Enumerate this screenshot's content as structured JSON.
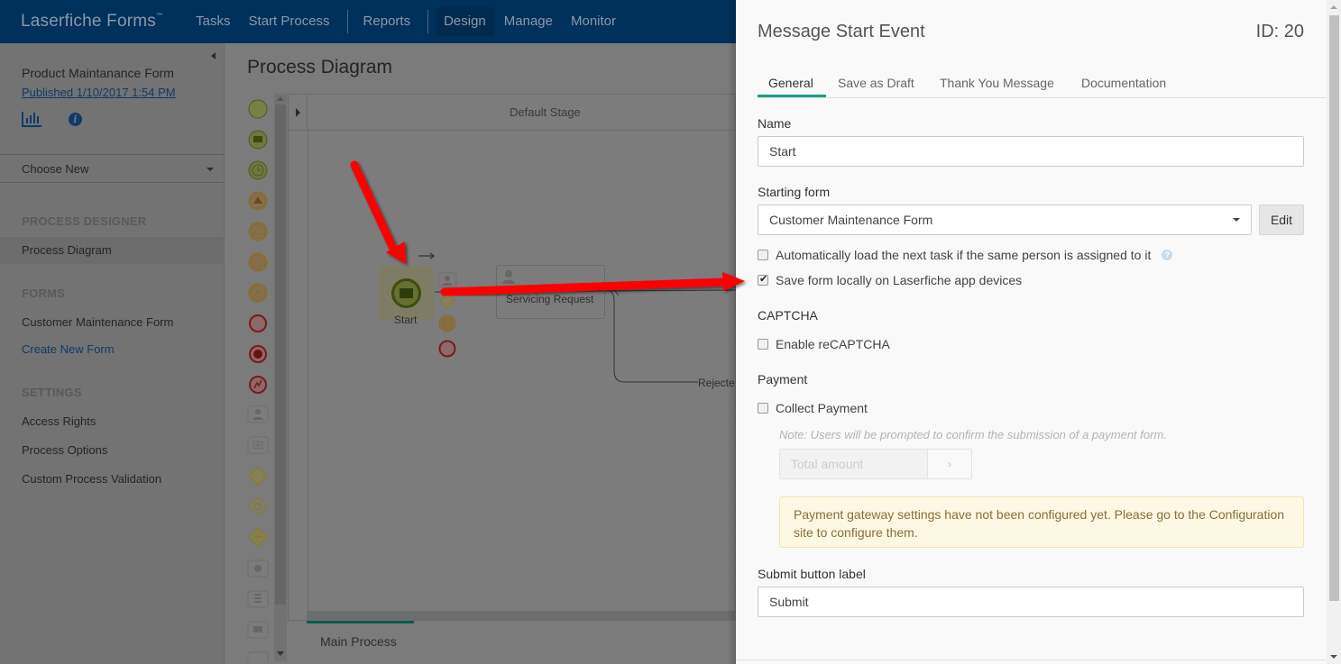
{
  "topnav": {
    "brand": "Laserfiche Forms",
    "brand_tm": "™",
    "items": [
      {
        "label": "Tasks"
      },
      {
        "label": "Start Process"
      },
      {
        "label": "Reports"
      },
      {
        "label": "Design",
        "active": true
      },
      {
        "label": "Manage"
      },
      {
        "label": "Monitor"
      }
    ]
  },
  "sidebar": {
    "process_name": "Product Maintanance Form",
    "published": "Published 1/10/2017 1:54 PM",
    "icons": [
      "report-chart-icon",
      "info-icon"
    ],
    "choose_new": "Choose New",
    "sections": [
      {
        "title": "PROCESS DESIGNER",
        "items": [
          {
            "label": "Process Diagram",
            "active": true
          }
        ]
      },
      {
        "title": "FORMS",
        "items": [
          {
            "label": "Customer Maintenance Form"
          },
          {
            "label": "Create New Form",
            "link": true
          }
        ]
      },
      {
        "title": "SETTINGS",
        "items": [
          {
            "label": "Access Rights"
          },
          {
            "label": "Process Options"
          },
          {
            "label": "Custom Process Validation"
          }
        ]
      }
    ]
  },
  "main": {
    "title": "Process Diagram",
    "stage_label": "Default Stage",
    "palette": [
      "start-event-icon",
      "message-start-event-icon",
      "timer-start-event-icon",
      "signal-throw-icon",
      "signal-catch-icon",
      "timer-intermediate-icon",
      "escalation-intermediate-icon",
      "end-event-icon",
      "terminate-end-icon",
      "error-end-icon",
      "user-task-icon",
      "subprocess-icon",
      "exclusive-gateway-icon",
      "inclusive-gateway-icon",
      "parallel-gateway-icon",
      "service-task-icon",
      "script-task-icon",
      "email-task-icon",
      "more-icon"
    ],
    "diagram": {
      "start_label": "Start",
      "task_label": "Servicing Request",
      "reject_label": "Rejecte"
    },
    "bottom_tab": "Main Process"
  },
  "panel": {
    "title": "Message Start Event",
    "id_label": "ID: 20",
    "tabs": [
      {
        "label": "General",
        "active": true
      },
      {
        "label": "Save as Draft"
      },
      {
        "label": "Thank You Message"
      },
      {
        "label": "Documentation"
      }
    ],
    "name_label": "Name",
    "name_value": "Start",
    "starting_form_label": "Starting form",
    "starting_form_value": "Customer Maintenance Form",
    "edit_label": "Edit",
    "auto_load_label": "Automatically load the next task if the same person is assigned to it",
    "auto_load_checked": false,
    "save_local_label": "Save form locally on Laserfiche app devices",
    "save_local_checked": true,
    "captcha_heading": "CAPTCHA",
    "captcha_label": "Enable reCAPTCHA",
    "captcha_checked": false,
    "payment_heading": "Payment",
    "payment_label": "Collect Payment",
    "payment_checked": false,
    "payment_note": "Note: Users will be prompted to confirm the submission of a payment form.",
    "total_amount_placeholder": "Total amount",
    "amount_button": "›",
    "alert_text": "Payment gateway settings have not been configured yet. Please go to the Configuration site to configure them.",
    "submit_label_heading": "Submit button label",
    "submit_label_value": "Submit"
  },
  "colors": {
    "nav_bg": "#00305c",
    "accent_tab": "#1aa08a",
    "alert_bg": "#fcf8e3",
    "alert_text": "#8a6d3b",
    "annotation_arrow": "#ff0000"
  }
}
